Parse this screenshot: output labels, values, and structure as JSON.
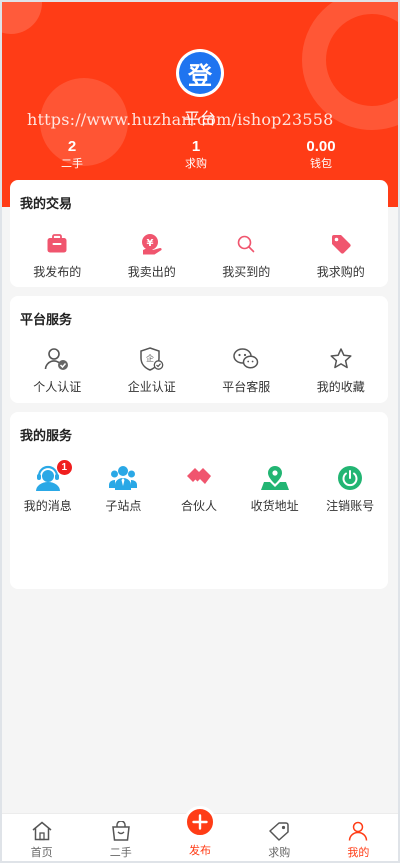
{
  "header": {
    "avatar_char": "登",
    "nickname": "平台",
    "watermark": "https://www.huzhan.com/ishop23558",
    "stats": [
      {
        "value": "2",
        "label": "二手"
      },
      {
        "value": "1",
        "label": "求购"
      },
      {
        "value": "0.00",
        "label": "钱包"
      }
    ]
  },
  "trade": {
    "title": "我的交易",
    "items": [
      {
        "label": "我发布的",
        "icon": "bag-icon"
      },
      {
        "label": "我卖出的",
        "icon": "yen-hand-icon"
      },
      {
        "label": "我买到的",
        "icon": "search-icon"
      },
      {
        "label": "我求购的",
        "icon": "tag-icon"
      }
    ]
  },
  "platform": {
    "title": "平台服务",
    "items": [
      {
        "label": "个人认证",
        "icon": "user-check-icon"
      },
      {
        "label": "企业认证",
        "icon": "enterprise-shield-icon"
      },
      {
        "label": "平台客服",
        "icon": "wechat-icon"
      },
      {
        "label": "我的收藏",
        "icon": "star-icon"
      }
    ]
  },
  "services": {
    "title": "我的服务",
    "items": [
      {
        "label": "我的消息",
        "icon": "headset-user-icon",
        "badge": "1"
      },
      {
        "label": "子站点",
        "icon": "group-icon"
      },
      {
        "label": "合伙人",
        "icon": "handshake-icon"
      },
      {
        "label": "收货地址",
        "icon": "map-pin-icon"
      },
      {
        "label": "注销账号",
        "icon": "power-icon"
      }
    ]
  },
  "tabbar": [
    {
      "label": "首页",
      "icon": "home-icon"
    },
    {
      "label": "二手",
      "icon": "shop-icon"
    },
    {
      "label": "发布",
      "icon": "plus-icon"
    },
    {
      "label": "求购",
      "icon": "tag-icon"
    },
    {
      "label": "我的",
      "icon": "user-icon"
    }
  ],
  "colors": {
    "brand": "#ff3c16",
    "trade_icon": "#f0556e",
    "service_blue": "#2aa8e6",
    "service_red": "#f0556e",
    "service_green": "#22b573"
  }
}
